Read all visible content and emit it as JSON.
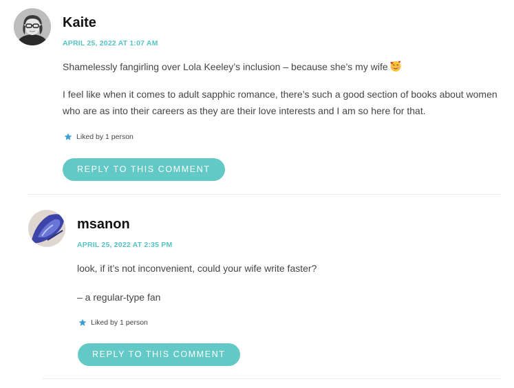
{
  "comments": [
    {
      "author": "Kaite",
      "date": "APRIL 25, 2022 AT 1:07 AM",
      "paragraphs": [
        "Shamelessly fangirling over Lola Keeley’s inclusion – because she’s my wife",
        "I feel like when it comes to adult sapphic romance, there’s such a good section of books about women who are as into their careers as they are their love interests and I am so here for that."
      ],
      "emoji": "smiling-face-with-hearts",
      "likes": "Liked by 1 person",
      "reply_label": "REPLY TO THIS COMMENT"
    },
    {
      "author": "msanon",
      "date": "APRIL 25, 2022 AT 2:35 PM",
      "paragraphs": [
        "look, if it’s not inconvenient, could your wife write faster?",
        "– a regular-type fan"
      ],
      "likes": "Liked by 1 person",
      "reply_label": "REPLY TO THIS COMMENT"
    }
  ],
  "colors": {
    "accent": "#62c9c6",
    "date": "#55c3c3",
    "like_star": "#3a9fd6"
  }
}
